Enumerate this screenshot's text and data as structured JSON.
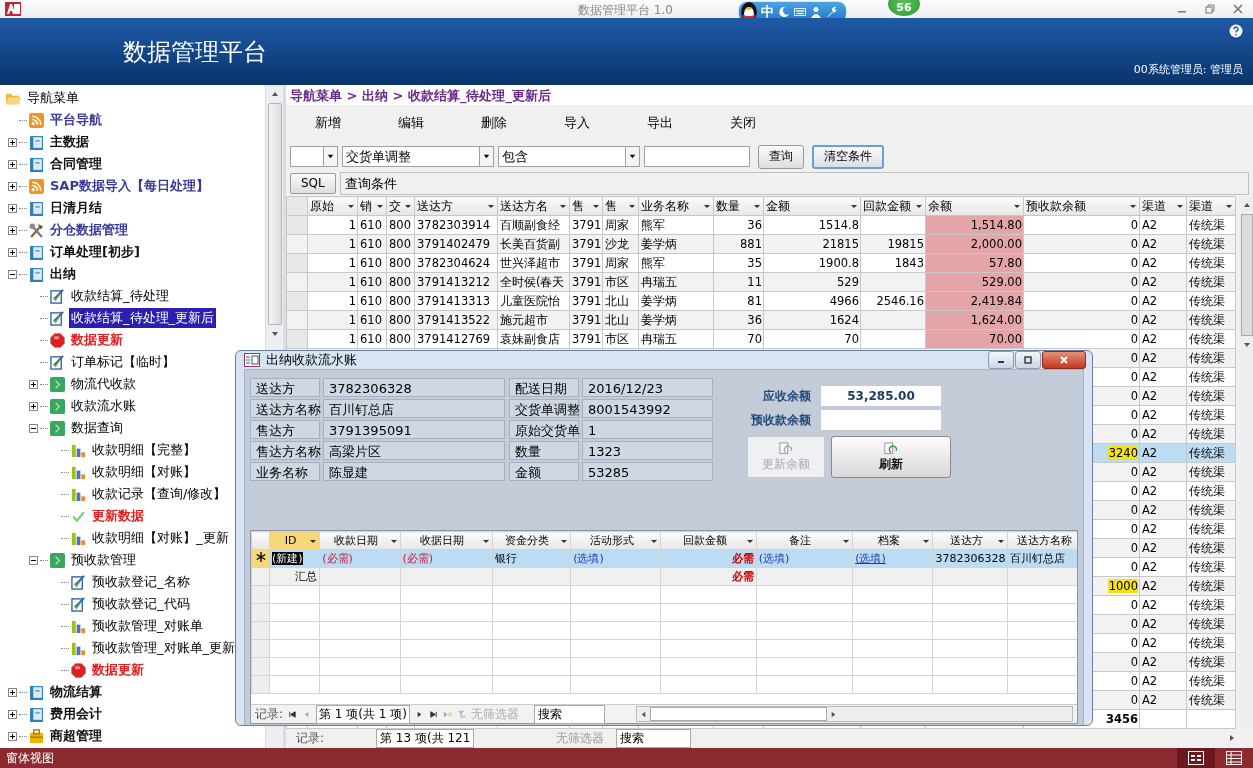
{
  "window": {
    "title": "数据管理平台 1.0",
    "ime_label": "中",
    "badge": "56"
  },
  "header": {
    "title": "数据管理平台",
    "user": "00系统管理员: 管理员"
  },
  "nav": {
    "root": {
      "label": "导航菜单",
      "children": [
        {
          "label": "平台导航",
          "kind": "feed",
          "selected": false
        },
        {
          "label": "主数据",
          "kind": "book",
          "expanded": false,
          "selected": false
        },
        {
          "label": "合同管理",
          "kind": "book",
          "expanded": false,
          "selected": false
        },
        {
          "label": "SAP数据导入【每日处理】",
          "kind": "feed",
          "expanded": false,
          "selected": false
        },
        {
          "label": "日清月结",
          "kind": "book",
          "expanded": false,
          "selected": false
        },
        {
          "label": "分仓数据管理",
          "kind": "tools",
          "expanded": false,
          "selected": false
        },
        {
          "label": "订单处理[初步]",
          "kind": "book",
          "expanded": false,
          "selected": false
        },
        {
          "label": "出纳",
          "kind": "book",
          "expanded": true,
          "selected": false,
          "children": [
            {
              "label": "收款结算_待处理",
              "kind": "form",
              "selected": false
            },
            {
              "label": "收款结算_待处理_更新后",
              "kind": "form",
              "selected": true
            },
            {
              "label": "数据更新",
              "kind": "stop",
              "selected": false
            },
            {
              "label": "订单标记【临时】",
              "kind": "form",
              "selected": false
            },
            {
              "label": "物流代收款",
              "kind": "group",
              "expanded": false,
              "selected": false
            },
            {
              "label": "收款流水账",
              "kind": "group",
              "expanded": false,
              "selected": false
            },
            {
              "label": "数据查询",
              "kind": "group",
              "expanded": true,
              "selected": false,
              "children": [
                {
                  "label": "收款明细【完整】",
                  "kind": "report",
                  "selected": false
                },
                {
                  "label": "收款明细【对账】",
                  "kind": "report",
                  "selected": false
                },
                {
                  "label": "收款记录【查询/修改】",
                  "kind": "report",
                  "selected": false
                },
                {
                  "label": "更新数据",
                  "kind": "check",
                  "selected": false
                },
                {
                  "label": "收款明细【对账】_更新",
                  "kind": "report",
                  "selected": false
                }
              ]
            },
            {
              "label": "预收款管理",
              "kind": "group",
              "expanded": true,
              "selected": false,
              "children": [
                {
                  "label": "预收款登记_名称",
                  "kind": "form",
                  "selected": false
                },
                {
                  "label": "预收款登记_代码",
                  "kind": "form",
                  "selected": false
                },
                {
                  "label": "预收款管理_对账单",
                  "kind": "report",
                  "selected": false
                },
                {
                  "label": "预收款管理_对账单_更新",
                  "kind": "report",
                  "selected": false
                },
                {
                  "label": "数据更新",
                  "kind": "stop",
                  "selected": false
                }
              ]
            }
          ]
        },
        {
          "label": "物流结算",
          "kind": "book",
          "expanded": false,
          "selected": false
        },
        {
          "label": "费用会计",
          "kind": "book",
          "expanded": false,
          "selected": false
        },
        {
          "label": "商超管理",
          "kind": "case",
          "expanded": false,
          "selected": false
        }
      ]
    }
  },
  "breadcrumb": "导航菜单 > 出纳 > 收款结算_待处理_更新后",
  "toolbar": [
    "新增",
    "编辑",
    "删除",
    "导入",
    "导出",
    "关闭"
  ],
  "filter": {
    "field": "交货单调整",
    "operator": "包含",
    "query_button": "查询",
    "clear_button": "清空条件",
    "sql_button": "SQL",
    "condition": "查询条件"
  },
  "table": {
    "columns": [
      {
        "label": "原始"
      },
      {
        "label": "销"
      },
      {
        "label": "交"
      },
      {
        "label": "送达方"
      },
      {
        "label": "送达方名"
      },
      {
        "label": "售"
      },
      {
        "label": "售"
      },
      {
        "label": "业务名称"
      },
      {
        "label": "数量"
      },
      {
        "label": "金额"
      },
      {
        "label": "回款金额"
      },
      {
        "label": "余额",
        "highlight": true
      },
      {
        "label": "预收款余额"
      },
      {
        "label": "渠道"
      },
      {
        "label": "渠道"
      }
    ],
    "rows": [
      {
        "selected": false,
        "flagged": false,
        "column_1": "1",
        "column_2": "610",
        "column_3": "800",
        "ship_to": "3782303914",
        "ship_to_name": "百顺副食经",
        "column_6": "3791",
        "column_7": "周家",
        "salesperson": "熊军",
        "quantity": "36",
        "amount": "1514.8",
        "balance": "1,514.80",
        "prepaid": "0",
        "channel": "A2",
        "column_15": "传统渠"
      },
      {
        "selected": false,
        "flagged": false,
        "column_1": "1",
        "column_2": "610",
        "column_3": "800",
        "ship_to": "3791402479",
        "ship_to_name": "长美百货副",
        "column_6": "3791",
        "column_7": "沙龙",
        "salesperson": "姜学炳",
        "quantity": "881",
        "amount": "21815",
        "received": "19815",
        "balance": "2,000.00",
        "prepaid": "0",
        "channel": "A2",
        "column_15": "传统渠"
      },
      {
        "selected": false,
        "flagged": false,
        "column_1": "1",
        "column_2": "610",
        "column_3": "800",
        "ship_to": "3782304624",
        "ship_to_name": "世兴泽超市",
        "column_6": "3791",
        "column_7": "周家",
        "salesperson": "熊军",
        "quantity": "35",
        "amount": "1900.8",
        "received": "1843",
        "balance": "57.80",
        "prepaid": "0",
        "channel": "A2",
        "column_15": "传统渠"
      },
      {
        "selected": false,
        "flagged": false,
        "column_1": "1",
        "column_2": "610",
        "column_3": "800",
        "ship_to": "3791413212",
        "ship_to_name": "全时侯(春天",
        "column_6": "3791",
        "column_7": "市区",
        "salesperson": "冉瑞五",
        "quantity": "11",
        "amount": "529",
        "balance": "529.00",
        "prepaid": "0",
        "channel": "A2",
        "column_15": "传统渠"
      },
      {
        "selected": false,
        "flagged": false,
        "column_1": "1",
        "column_2": "610",
        "column_3": "800",
        "ship_to": "3791413313",
        "ship_to_name": "儿童医院怡",
        "column_6": "3791",
        "column_7": "北山",
        "salesperson": "姜学炳",
        "quantity": "81",
        "amount": "4966",
        "received": "2546.16",
        "balance": "2,419.84",
        "prepaid": "0",
        "channel": "A2",
        "column_15": "传统渠"
      },
      {
        "selected": false,
        "flagged": false,
        "column_1": "1",
        "column_2": "610",
        "column_3": "800",
        "ship_to": "3791413522",
        "ship_to_name": "施元超市",
        "column_6": "3791",
        "column_7": "北山",
        "salesperson": "姜学炳",
        "quantity": "36",
        "amount": "1624",
        "balance": "1,624.00",
        "prepaid": "0",
        "channel": "A2",
        "column_15": "传统渠"
      },
      {
        "selected": false,
        "flagged": false,
        "column_1": "1",
        "column_2": "610",
        "column_3": "800",
        "ship_to": "3791412769",
        "ship_to_name": "袁妹副食店",
        "column_6": "3791",
        "column_7": "市区",
        "salesperson": "冉瑞五",
        "quantity": "70",
        "amount": "70",
        "balance": "70.00",
        "prepaid": "0",
        "channel": "A2",
        "column_15": "传统渠"
      },
      {
        "selected": false,
        "flagged": false,
        "prepaid": "0",
        "channel": "A2",
        "column_15": "传统渠"
      },
      {
        "selected": false,
        "flagged": false,
        "prepaid": "0",
        "channel": "A2",
        "column_15": "传统渠"
      },
      {
        "selected": false,
        "flagged": false,
        "prepaid": "0",
        "channel": "A2",
        "column_15": "传统渠"
      },
      {
        "selected": false,
        "flagged": false,
        "prepaid": "0",
        "channel": "A2",
        "column_15": "传统渠"
      },
      {
        "selected": false,
        "flagged": false,
        "prepaid": "0",
        "channel": "A2",
        "column_15": "传统渠"
      },
      {
        "selected": true,
        "flagged": true,
        "prepaid": "3240",
        "channel": "A2",
        "column_15": "传统渠"
      },
      {
        "selected": false,
        "flagged": false,
        "prepaid": "0",
        "channel": "A2",
        "column_15": "传统渠"
      },
      {
        "selected": false,
        "flagged": false,
        "prepaid": "0",
        "channel": "A2",
        "column_15": "传统渠"
      },
      {
        "selected": false,
        "flagged": false,
        "prepaid": "0",
        "channel": "A2",
        "column_15": "传统渠"
      },
      {
        "selected": false,
        "flagged": false,
        "prepaid": "0",
        "channel": "A2",
        "column_15": "传统渠"
      },
      {
        "selected": false,
        "flagged": false,
        "prepaid": "0",
        "channel": "A2",
        "column_15": "传统渠"
      },
      {
        "selected": false,
        "flagged": false,
        "prepaid": "0",
        "channel": "A2",
        "column_15": "传统渠"
      },
      {
        "selected": false,
        "flagged": true,
        "prepaid": "1000",
        "channel": "A2",
        "column_15": "传统渠"
      },
      {
        "selected": false,
        "flagged": false,
        "prepaid": "0",
        "channel": "A2",
        "column_15": "传统渠"
      },
      {
        "selected": false,
        "flagged": false,
        "prepaid": "0",
        "channel": "A2",
        "column_15": "传统渠"
      },
      {
        "selected": false,
        "flagged": false,
        "prepaid": "0",
        "channel": "A2",
        "column_15": "传统渠"
      },
      {
        "selected": false,
        "flagged": false,
        "prepaid": "0",
        "channel": "A2",
        "column_15": "传统渠"
      },
      {
        "selected": false,
        "flagged": false,
        "prepaid": "0",
        "channel": "A2",
        "column_15": "传统渠"
      },
      {
        "selected": false,
        "flagged": false,
        "prepaid": "0",
        "channel": "A2",
        "column_15": "传统渠"
      }
    ],
    "total": "3456",
    "navigator": {
      "label": "记录:",
      "position": "第 13 项(共 121",
      "filter": "无筛选器",
      "search": "搜索"
    }
  },
  "dialog": {
    "title": "出纳收款流水账",
    "fields_left": [
      {
        "label": "送达方",
        "value": "3782306328"
      },
      {
        "label": "送达方名称",
        "value": "百川钉总店"
      },
      {
        "label": "售达方",
        "value": "3791395091"
      },
      {
        "label": "售达方名称",
        "value": "高梁片区"
      },
      {
        "label": "业务名称",
        "value": "陈显建"
      }
    ],
    "fields_right": [
      {
        "label": "配送日期",
        "value": "2016/12/23"
      },
      {
        "label": "交货单调整",
        "value": "8001543992"
      },
      {
        "label": "原始交货单",
        "value": "1"
      },
      {
        "label": "数量",
        "value": "1323"
      },
      {
        "label": "金额",
        "value": "53285"
      }
    ],
    "balances": [
      {
        "label": "应收余额",
        "value": "53,285.00"
      },
      {
        "label": "预收款余额"
      }
    ],
    "buttons": [
      {
        "label": "更新余额",
        "disabled": true
      },
      {
        "label": "刷新",
        "disabled": false
      }
    ],
    "grid": {
      "columns": [
        "ID",
        "收款日期",
        "收据日期",
        "资金分类",
        "活动形式",
        "回款金额",
        "备注",
        "档案",
        "送达方",
        "送达方名称"
      ],
      "new_row": [
        {
          "text": "(新建)",
          "kind": "current"
        },
        {
          "text": "(必需)",
          "kind": "required"
        },
        {
          "text": "(必需)",
          "kind": "required"
        },
        {
          "text": "银行",
          "kind": "plain"
        },
        {
          "text": "(选填)",
          "kind": "optional"
        },
        {
          "text": "必需",
          "kind": "required_strong"
        },
        {
          "text": "(选填)",
          "kind": "optional"
        },
        {
          "text": "(选填)",
          "kind": "link"
        },
        {
          "text": "3782306328",
          "kind": "plain"
        },
        {
          "text": "百川钉总店",
          "kind": "plain"
        }
      ],
      "total_row": {
        "label": "汇总",
        "amount": "必需"
      },
      "navigator": {
        "label": "记录:",
        "position": "第 1 项(共 1 项)",
        "filter": "无筛选器",
        "search": "搜索"
      }
    }
  },
  "status_bar": {
    "text": "窗体视图"
  }
}
